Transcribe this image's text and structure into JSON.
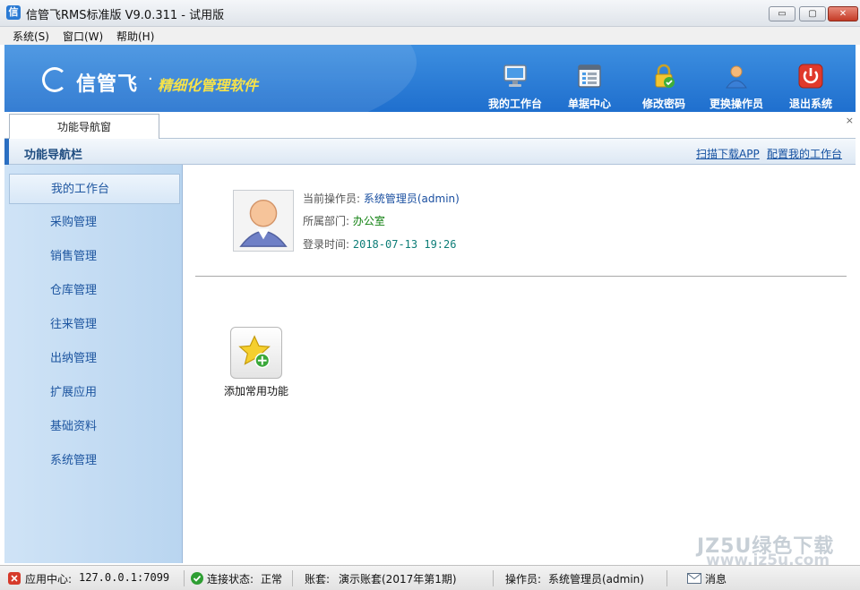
{
  "window": {
    "title": "信管飞RMS标准版 V9.0.311 - 试用版",
    "app_icon": "信"
  },
  "window_controls": {
    "minimize": "▭",
    "maximize": "▢",
    "close": "✕"
  },
  "menu": [
    {
      "label": "系统(S)"
    },
    {
      "label": "窗口(W)"
    },
    {
      "label": "帮助(H)"
    }
  ],
  "banner": {
    "logo": "信管飞",
    "dot": "·",
    "slogan": "精细化管理软件",
    "tools": [
      {
        "label": "我的工作台",
        "icon": "monitor-icon"
      },
      {
        "label": "单据中心",
        "icon": "document-list-icon"
      },
      {
        "label": "修改密码",
        "icon": "lock-icon"
      },
      {
        "label": "更换操作员",
        "icon": "user-icon"
      },
      {
        "label": "退出系统",
        "icon": "power-icon"
      }
    ]
  },
  "tabs": [
    {
      "label": "功能导航窗"
    }
  ],
  "tab_close": "×",
  "nav": {
    "title": "功能导航栏",
    "links": [
      {
        "label": "扫描下载APP"
      },
      {
        "label": "配置我的工作台"
      }
    ],
    "items": [
      {
        "label": "我的工作台",
        "active": true
      },
      {
        "label": "采购管理"
      },
      {
        "label": "销售管理"
      },
      {
        "label": "仓库管理"
      },
      {
        "label": "往来管理"
      },
      {
        "label": "出纳管理"
      },
      {
        "label": "扩展应用"
      },
      {
        "label": "基础资料"
      },
      {
        "label": "系统管理"
      }
    ]
  },
  "profile": {
    "operator_label": "当前操作员:",
    "operator_value": "系统管理员(admin)",
    "dept_label": "所属部门:",
    "dept_value": "办公室",
    "login_label": "登录时间:",
    "login_value": "2018-07-13 19:26"
  },
  "favorites": {
    "add_label": "添加常用功能"
  },
  "watermark": {
    "line1": "JZ5U绿色下载",
    "line2": "www.jz5u.com"
  },
  "status": {
    "app_center_label": "应用中心:",
    "app_center_value": "127.0.0.1:7099",
    "conn_label": "连接状态:",
    "conn_value": "正常",
    "account_label": "账套:",
    "account_value": "演示账套(2017年第1期)",
    "operator_label": "操作员:",
    "operator_value": "系统管理员(admin)",
    "msg_label": "消息"
  },
  "colors": {
    "banner": "#2a7ad4",
    "nav_text": "#1e56a0",
    "slogan": "#f6e24a",
    "sidebar": "#c4dcf3"
  }
}
